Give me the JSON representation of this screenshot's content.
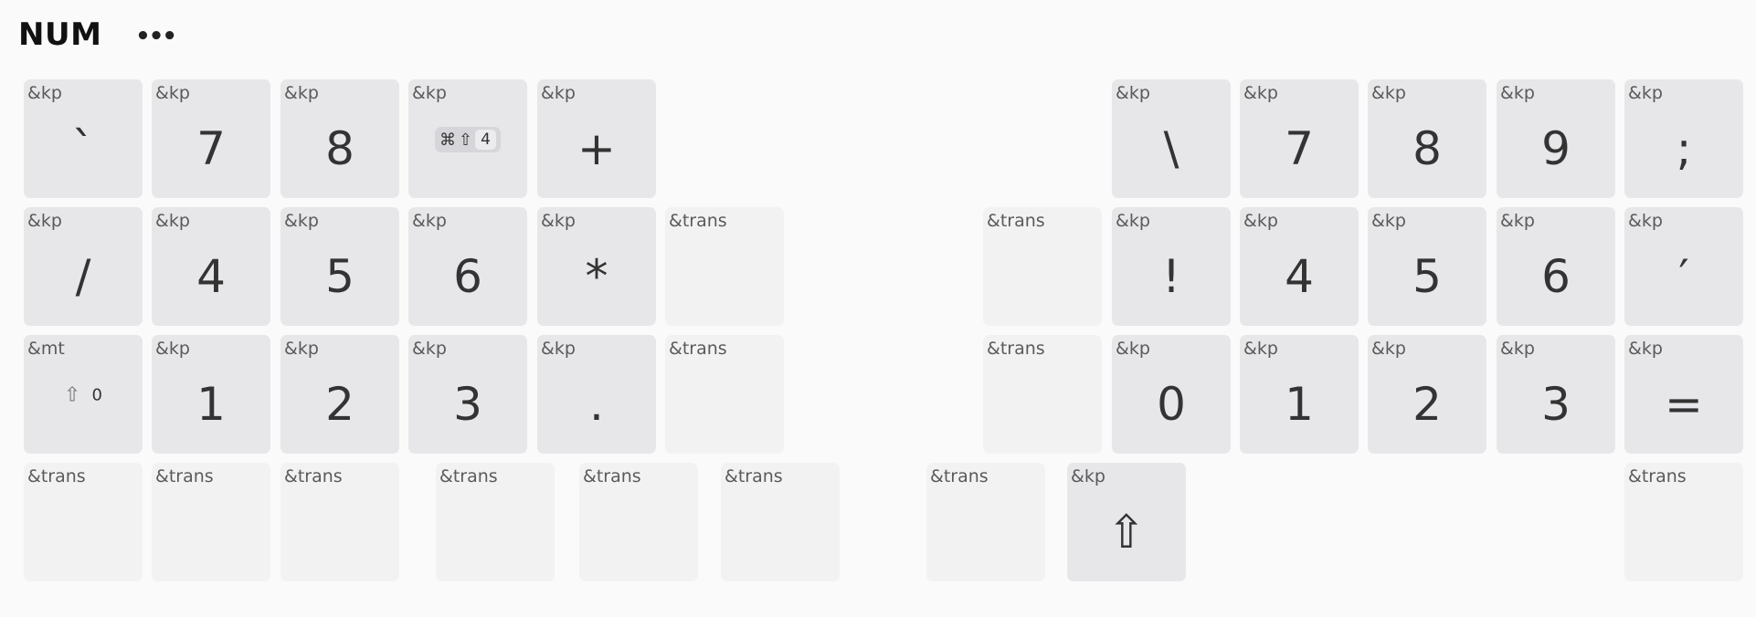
{
  "layer": {
    "title": "NUM",
    "menu_label": "•••"
  },
  "keys": [
    {
      "b": "&kp",
      "l": "`"
    },
    {
      "b": "&kp",
      "l": "7"
    },
    {
      "b": "&kp",
      "l": "8"
    },
    {
      "b": "&kp",
      "combo": [
        "⌘",
        "⇧",
        "4"
      ]
    },
    {
      "b": "&kp",
      "l": "+"
    },
    {
      "b": "&kp",
      "l": "\\"
    },
    {
      "b": "&kp",
      "l": "7"
    },
    {
      "b": "&kp",
      "l": "8"
    },
    {
      "b": "&kp",
      "l": "9"
    },
    {
      "b": "&kp",
      "l": ";"
    },
    {
      "b": "&kp",
      "l": "/"
    },
    {
      "b": "&kp",
      "l": "4"
    },
    {
      "b": "&kp",
      "l": "5"
    },
    {
      "b": "&kp",
      "l": "6"
    },
    {
      "b": "&kp",
      "l": "*"
    },
    {
      "b": "&trans",
      "trans": true
    },
    {
      "b": "&trans",
      "trans": true
    },
    {
      "b": "&kp",
      "l": "!"
    },
    {
      "b": "&kp",
      "l": "4"
    },
    {
      "b": "&kp",
      "l": "5"
    },
    {
      "b": "&kp",
      "l": "6"
    },
    {
      "b": "&kp",
      "l": "′"
    },
    {
      "b": "&mt",
      "mt": [
        "⇧",
        "0"
      ]
    },
    {
      "b": "&kp",
      "l": "1"
    },
    {
      "b": "&kp",
      "l": "2"
    },
    {
      "b": "&kp",
      "l": "3"
    },
    {
      "b": "&kp",
      "l": "."
    },
    {
      "b": "&trans",
      "trans": true
    },
    {
      "b": "&trans",
      "trans": true
    },
    {
      "b": "&kp",
      "l": "0"
    },
    {
      "b": "&kp",
      "l": "1"
    },
    {
      "b": "&kp",
      "l": "2"
    },
    {
      "b": "&kp",
      "l": "3"
    },
    {
      "b": "&kp",
      "l": "="
    },
    {
      "b": "&trans",
      "trans": true
    },
    {
      "b": "&trans",
      "trans": true
    },
    {
      "b": "&trans",
      "trans": true
    },
    {
      "b": "&trans",
      "trans": true
    },
    {
      "b": "&trans",
      "trans": true
    },
    {
      "b": "&trans",
      "trans": true
    },
    {
      "b": "&trans",
      "trans": true
    },
    {
      "b": "&kp",
      "l": "⇧"
    },
    {
      "b": "&trans",
      "trans": true
    }
  ]
}
